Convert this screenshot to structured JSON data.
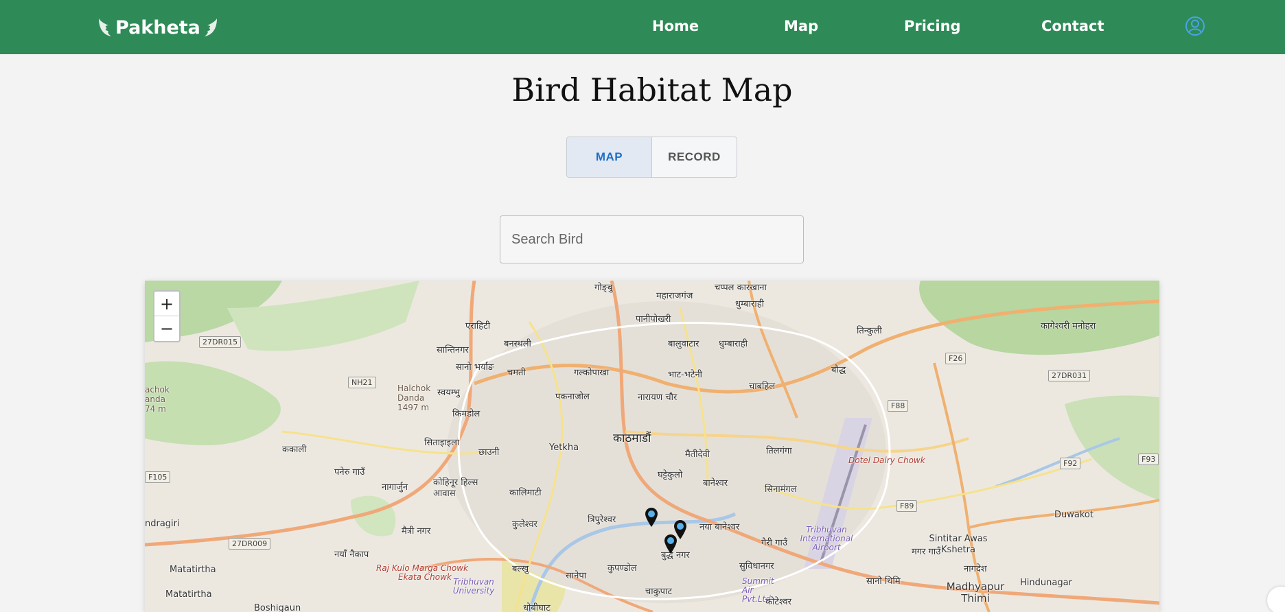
{
  "header": {
    "brand": "Pakheta",
    "nav": [
      "Home",
      "Map",
      "Pricing",
      "Contact"
    ],
    "brand_color": "#2e8b57"
  },
  "page": {
    "title": "Bird Habitat Map"
  },
  "toggle": {
    "active": "MAP",
    "inactive": "RECORD",
    "active_color": "#1e6fc9"
  },
  "search": {
    "placeholder": "Search Bird",
    "value": ""
  },
  "map": {
    "zoom_in": "+",
    "zoom_out": "−",
    "labels": [
      "गोङ्बु",
      "महाराजगंज",
      "चप्पल कारखाना",
      "एराहिटी",
      "पानीपोखरी",
      "धुम्बाराही",
      "तिन्कुली",
      "कागेश्वरी मनोहरा",
      "सान्तिनगर",
      "बनस्थली",
      "बालुवाटार",
      "धुम्बाराही",
      "सानो भर्याङ",
      "चमती",
      "गल्कोपाखा",
      "भाट-भटेनी",
      "चाबहिल",
      "बौद्ध",
      "Halchok Danda 1497 m",
      "स्वयम्भु",
      "पकनाजोल",
      "नारायण चौर",
      "किमडोल",
      "काठमाडौं",
      "सिताइाइला",
      "छाउनी",
      "Yetkha",
      "मैतीदेवी",
      "तिलगंगा",
      "ककाली",
      "पनेरु गाउँ",
      "घट्टेकुलो",
      "बानेश्वर",
      "नागार्जुन",
      "कोहिनूर हिल्स आवास",
      "कालिमाटी",
      "सिनामंगल",
      "Dotel Dairy Chowk",
      "त्रिपुरेश्वर",
      "कुलेश्वर",
      "नया बानेश्वर",
      "Duwakot",
      "ndragiri",
      "मैत्री नगर",
      "गैरी गाउँ",
      "Tribhuvan International Airport",
      "Sintitar Awas Kshetra",
      "नयाँ नैकाप",
      "बुद्ध नगर",
      "मगर गाउँ",
      "Raj Kulo Marga Chowk",
      "Ekata Chowk",
      "बल्खु",
      "कुपण्डोल",
      "सुविधानगर",
      "नागदेश",
      "Matatirtha",
      "Tribhuvan University",
      "सानेपा",
      "Summit Air Pvt.Ltd",
      "सानो थिमि",
      "Hindunagar",
      "Madhyapur Thimi",
      "Matatirtha",
      "Boshigaun",
      "धोबीघाट",
      "चाकुपाट",
      "कोटेश्वर",
      "achok anda 74 m"
    ],
    "shields": [
      "27DR015",
      "NH21",
      "F26",
      "27DR031",
      "F88",
      "F105",
      "F92",
      "F93",
      "27DR009",
      "F89"
    ],
    "markers": 3
  }
}
